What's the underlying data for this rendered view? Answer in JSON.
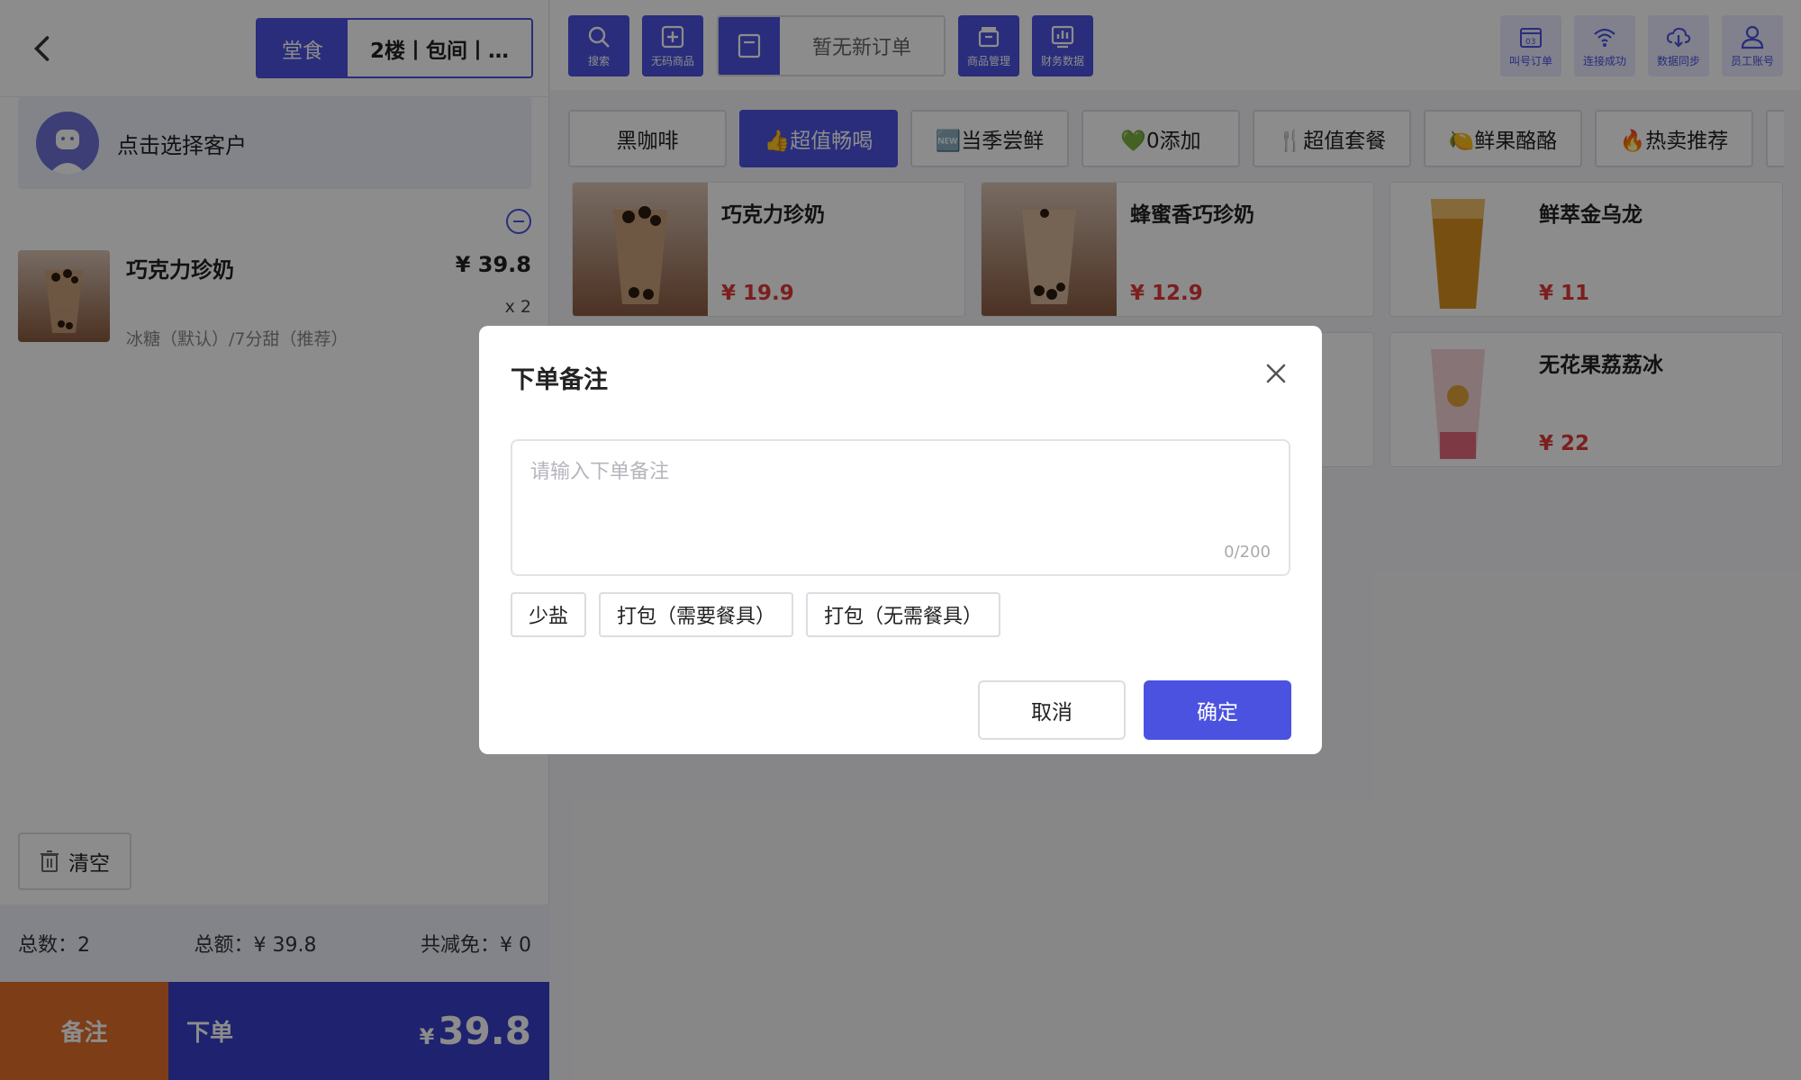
{
  "left": {
    "back_icon": "chevron-left-icon",
    "mode_label": "堂食",
    "seat_label": "2楼丨包间丨…",
    "customer_label": "点击选择客户",
    "order_item": {
      "name": "巧克力珍奶",
      "price": "¥ 39.8",
      "qty": "x 2",
      "spec": "冰糖（默认）/7分甜（推荐）"
    },
    "clear_label": "清空",
    "summary": {
      "count": "总数：2",
      "total": "总额：¥ 39.8",
      "discount": "共减免：¥ 0"
    },
    "note_label": "备注",
    "submit_label": "下单",
    "submit_yen": "¥",
    "submit_total": "39.8"
  },
  "toolbar": {
    "search": "搜索",
    "nocode": "无码商品",
    "neworder": "暂无新订单",
    "goods": "商品管理",
    "finance": "财务数据",
    "callnum": "叫号订单",
    "wifi": "连接成功",
    "sync": "数据同步",
    "staff": "员工账号"
  },
  "categories": [
    "黑咖啡",
    "👍超值畅喝",
    "🆕当季尝鲜",
    "💚0添加",
    "🍴超值套餐",
    "🍋鲜果酪酪",
    "🔥热卖推荐"
  ],
  "products": [
    {
      "name": "巧克力珍奶",
      "price": "¥ 19.9"
    },
    {
      "name": "蜂蜜香巧珍奶",
      "price": "¥ 12.9"
    },
    {
      "name": "鲜萃金乌龙",
      "price": "¥ 11"
    },
    {
      "name": "无花果荔荔冰",
      "price": "¥ 22"
    }
  ],
  "modal": {
    "title": "下单备注",
    "placeholder": "请输入下单备注",
    "counter": "0/200",
    "tags": [
      "少盐",
      "打包（需要餐具）",
      "打包（无需餐具）"
    ],
    "cancel": "取消",
    "confirm": "确定"
  },
  "colors": {
    "accent": "#4b52e0",
    "note_orange": "#e2702a",
    "price_red": "#e03a3a"
  }
}
